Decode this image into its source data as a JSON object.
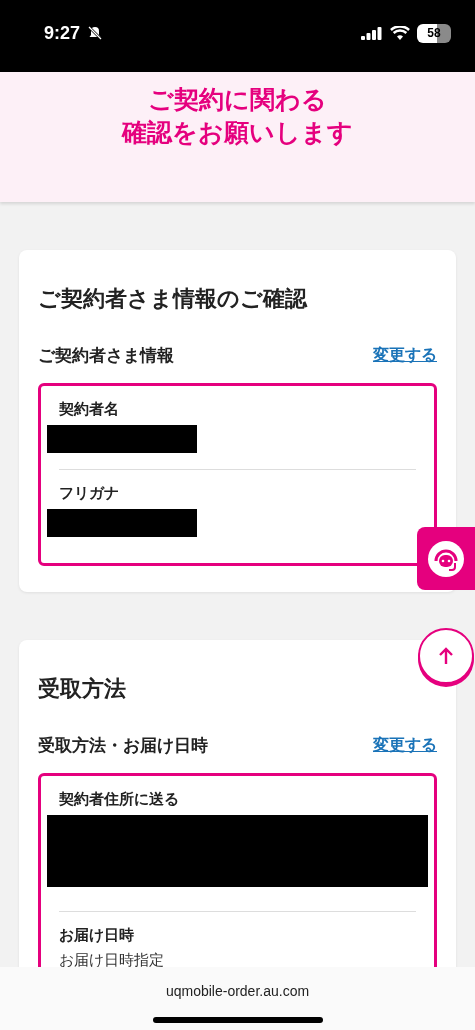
{
  "status_bar": {
    "time": "9:27",
    "battery": "58"
  },
  "header": {
    "lines": [
      "ご契約に関わる",
      "確認をお願いします"
    ]
  },
  "sections": [
    {
      "title": "ご契約者さま情報のご確認",
      "subtitle": "ご契約者さま情報",
      "link": "変更する",
      "fields": [
        {
          "kind": "redacted",
          "label": "契約者名"
        },
        {
          "kind": "redacted",
          "label": "フリガナ"
        }
      ]
    },
    {
      "title": "受取方法",
      "subtitle": "受取方法・お届け日時",
      "link": "変更する",
      "fields": [
        {
          "kind": "blackout",
          "label": "契約者住所に送る"
        },
        {
          "kind": "text",
          "label": "お届け日時",
          "value": "お届け日時指定"
        }
      ]
    }
  ],
  "browser": {
    "url": "uqmobile-order.au.com"
  }
}
